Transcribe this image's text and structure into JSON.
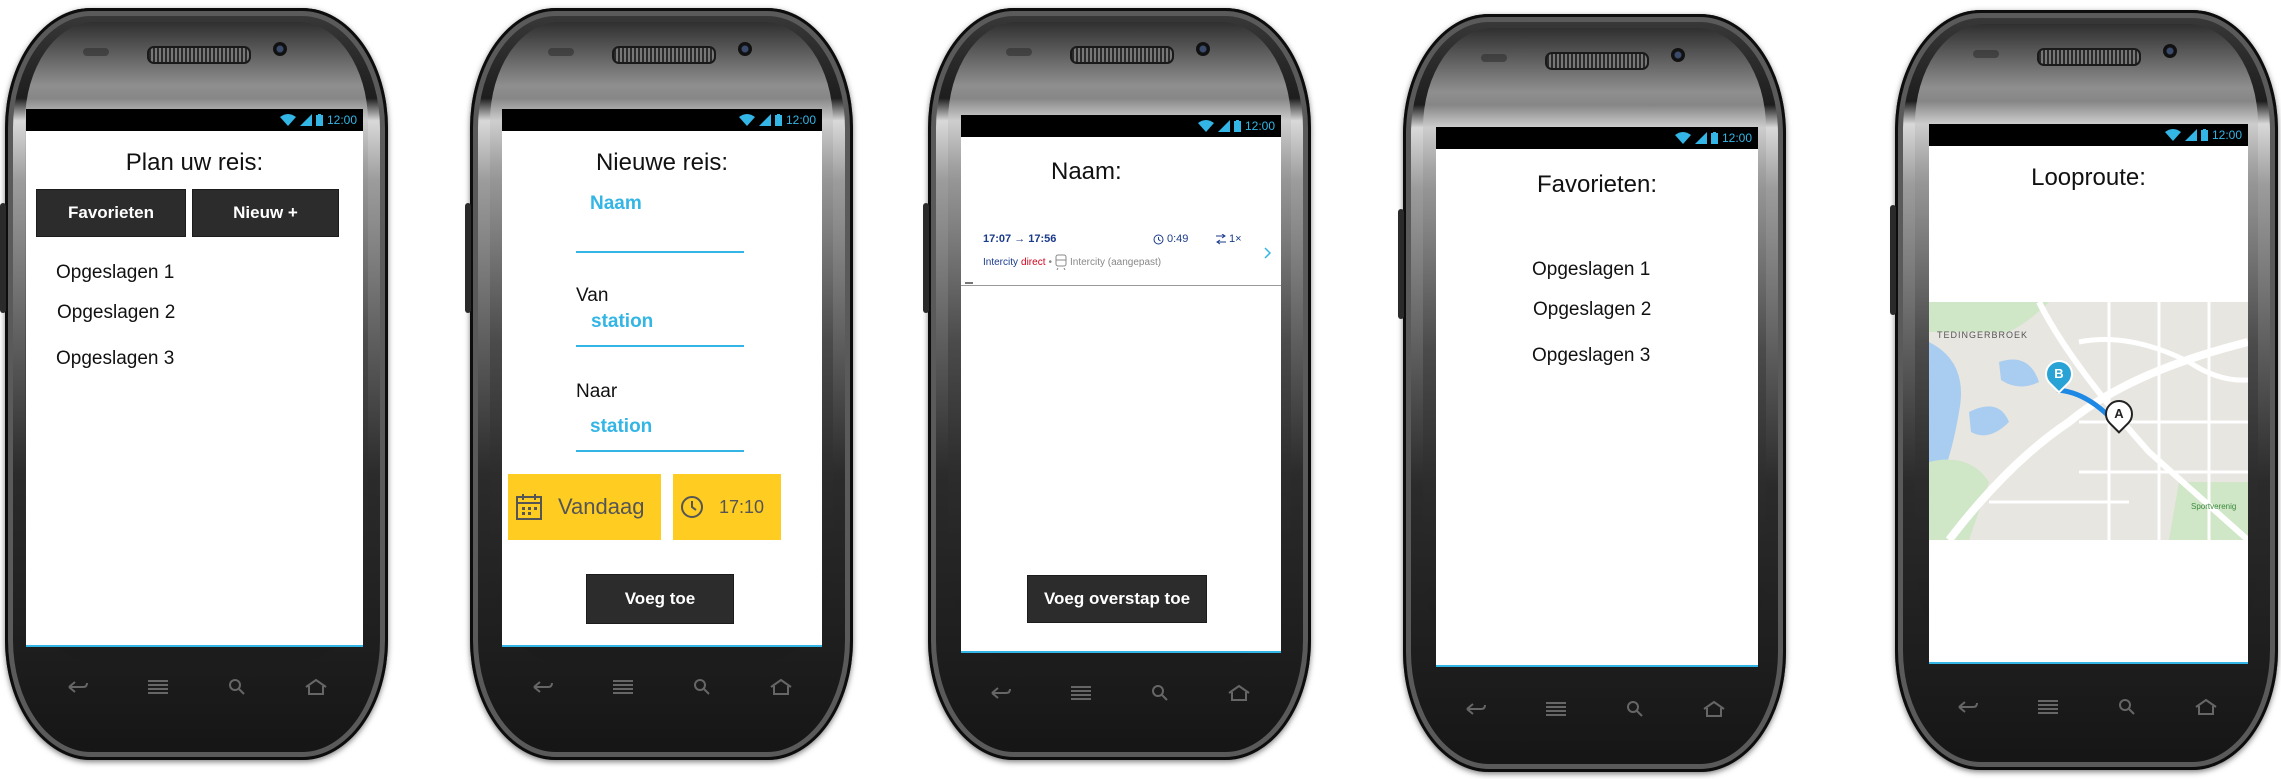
{
  "status": {
    "time": "12:00"
  },
  "screens": {
    "plan": {
      "title": "Plan uw reis:",
      "favorites_button": "Favorieten",
      "new_button": "Nieuw +",
      "saved": [
        "Opgeslagen 1",
        "Opgeslagen 2",
        "Opgeslagen 3"
      ]
    },
    "new_trip": {
      "title": "Nieuwe reis:",
      "name_field": "Naam",
      "from_label": "Van",
      "from_field": "station",
      "to_label": "Naar",
      "to_field": "station",
      "date_label": "Vandaag",
      "time_label": "17:10",
      "add_button": "Voeg toe"
    },
    "trip_name": {
      "title": "Naam:",
      "trip": {
        "depart": "17:07",
        "arrive": "17:56",
        "duration": "0:49",
        "transfers": "1×",
        "train1": "Intercity",
        "train1_tag": "direct",
        "train2": "Intercity (aangepast)"
      },
      "add_transfer_button": "Voeg overstap toe"
    },
    "favorites": {
      "title": "Favorieten:",
      "saved": [
        "Opgeslagen 1",
        "Opgeslagen 2",
        "Opgeslagen 3"
      ]
    },
    "walk": {
      "title": "Looproute:",
      "map": {
        "area_label": "TEDINGERBROEK",
        "park_label": "Sportverenig",
        "marker_a": "A",
        "marker_b": "B"
      }
    }
  },
  "colors": {
    "accent": "#33b5e5",
    "button": "#2c2c2c",
    "highlight": "#ffcc22"
  }
}
